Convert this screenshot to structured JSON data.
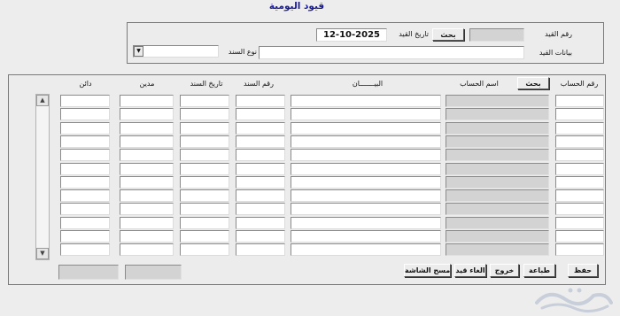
{
  "window": {
    "title": "قيود اليومية"
  },
  "header": {
    "entry_number_label": "رقم القيد",
    "entry_number_value": "",
    "search_label": "بحث",
    "entry_date_label": "تاريخ القيد",
    "entry_date_value": "12-10-2025",
    "entry_details_label": "بيانات القيد",
    "entry_details_value": "",
    "doc_type_label": "نوع السند",
    "doc_type_value": ""
  },
  "grid": {
    "headers": {
      "account_number": "رقم الحساب",
      "search": "بحث",
      "account_name": "اسم الحساب",
      "description": "البيـــــــان",
      "doc_number": "رقم السند",
      "doc_date": "تاريخ السند",
      "debit": "مدين",
      "credit": "دائن"
    },
    "row_count": 12,
    "scroll_up": "▲",
    "scroll_down": "▼"
  },
  "totals": {
    "debit_total": "",
    "credit_total": ""
  },
  "actions": {
    "save": "حفظ",
    "print": "طباعة",
    "exit": "خروج",
    "cancel_entry": "الغاء قيد",
    "clear_screen": "مسح الشاشة"
  },
  "icons": {
    "dropdown": "dropdown-arrow-icon",
    "watermark": "haraj-watermark-icon"
  },
  "colors": {
    "title": "#1a1aa0",
    "background": "#ededed"
  }
}
